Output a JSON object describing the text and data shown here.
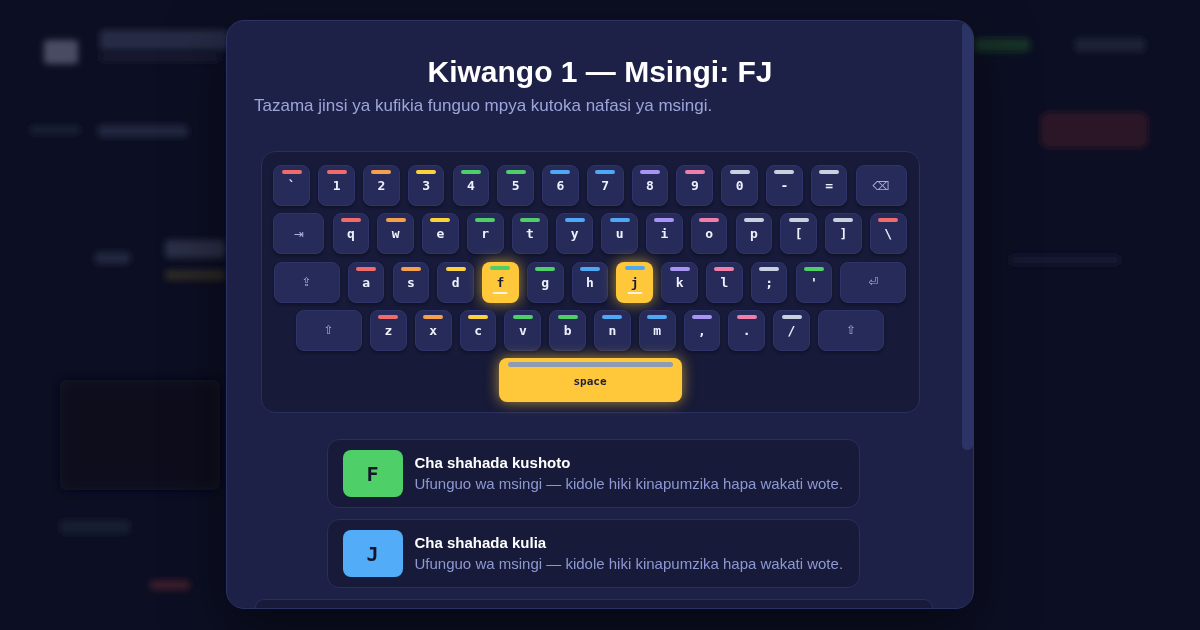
{
  "dialog": {
    "title": "Kiwango 1 — Msingi: FJ",
    "subtitle": "Tazama jinsi ya kufikia funguo mpya kutoka nafasi ya msingi.",
    "keyboard": {
      "rows": [
        [
          {
            "label": "`",
            "kind": "char",
            "color": "#f26b6b",
            "highlighted": false,
            "bump": false
          },
          {
            "label": "1",
            "kind": "char",
            "color": "#f26b6b",
            "highlighted": false,
            "bump": false
          },
          {
            "label": "2",
            "kind": "char",
            "color": "#f7a04b",
            "highlighted": false,
            "bump": false
          },
          {
            "label": "3",
            "kind": "char",
            "color": "#fdd23c",
            "highlighted": false,
            "bump": false
          },
          {
            "label": "4",
            "kind": "char",
            "color": "#4fcf67",
            "highlighted": false,
            "bump": false
          },
          {
            "label": "5",
            "kind": "char",
            "color": "#4fcf67",
            "highlighted": false,
            "bump": false
          },
          {
            "label": "6",
            "kind": "char",
            "color": "#4ea8f4",
            "highlighted": false,
            "bump": false
          },
          {
            "label": "7",
            "kind": "char",
            "color": "#4ea8f4",
            "highlighted": false,
            "bump": false
          },
          {
            "label": "8",
            "kind": "char",
            "color": "#a895f3",
            "highlighted": false,
            "bump": false
          },
          {
            "label": "9",
            "kind": "char",
            "color": "#f07ea8",
            "highlighted": false,
            "bump": false
          },
          {
            "label": "0",
            "kind": "char",
            "color": "#c9d0df",
            "highlighted": false,
            "bump": false
          },
          {
            "label": "-",
            "kind": "char",
            "color": "#c9d0df",
            "highlighted": false,
            "bump": false
          },
          {
            "label": "=",
            "kind": "char",
            "color": "#c9d0df",
            "highlighted": false,
            "bump": false
          },
          {
            "label": "⌫",
            "kind": "backspace",
            "highlighted": false,
            "bump": false
          }
        ],
        [
          {
            "label": "⇥",
            "kind": "tab",
            "highlighted": false,
            "bump": false
          },
          {
            "label": "q",
            "kind": "char",
            "color": "#f26b6b",
            "highlighted": false,
            "bump": false
          },
          {
            "label": "w",
            "kind": "char",
            "color": "#f7a04b",
            "highlighted": false,
            "bump": false
          },
          {
            "label": "e",
            "kind": "char",
            "color": "#fdd23c",
            "highlighted": false,
            "bump": false
          },
          {
            "label": "r",
            "kind": "char",
            "color": "#4fcf67",
            "highlighted": false,
            "bump": false
          },
          {
            "label": "t",
            "kind": "char",
            "color": "#4fcf67",
            "highlighted": false,
            "bump": false
          },
          {
            "label": "y",
            "kind": "char",
            "color": "#4ea8f4",
            "highlighted": false,
            "bump": false
          },
          {
            "label": "u",
            "kind": "char",
            "color": "#4ea8f4",
            "highlighted": false,
            "bump": false
          },
          {
            "label": "i",
            "kind": "char",
            "color": "#a895f3",
            "highlighted": false,
            "bump": false
          },
          {
            "label": "o",
            "kind": "char",
            "color": "#f07ea8",
            "highlighted": false,
            "bump": false
          },
          {
            "label": "p",
            "kind": "char",
            "color": "#c9d0df",
            "highlighted": false,
            "bump": false
          },
          {
            "label": "[",
            "kind": "char",
            "color": "#c9d0df",
            "highlighted": false,
            "bump": false
          },
          {
            "label": "]",
            "kind": "char",
            "color": "#c9d0df",
            "highlighted": false,
            "bump": false
          },
          {
            "label": "\\",
            "kind": "char",
            "color": "#f26b6b",
            "highlighted": false,
            "bump": false
          }
        ],
        [
          {
            "label": "⇪",
            "kind": "caps",
            "highlighted": false,
            "bump": false
          },
          {
            "label": "a",
            "kind": "char",
            "color": "#f26b6b",
            "highlighted": false,
            "bump": false
          },
          {
            "label": "s",
            "kind": "char",
            "color": "#f7a04b",
            "highlighted": false,
            "bump": false
          },
          {
            "label": "d",
            "kind": "char",
            "color": "#fdd23c",
            "highlighted": false,
            "bump": false
          },
          {
            "label": "f",
            "kind": "char",
            "color": "#4fcf67",
            "highlighted": true,
            "bump": true
          },
          {
            "label": "g",
            "kind": "char",
            "color": "#4fcf67",
            "highlighted": false,
            "bump": false
          },
          {
            "label": "h",
            "kind": "char",
            "color": "#4ea8f4",
            "highlighted": false,
            "bump": false
          },
          {
            "label": "j",
            "kind": "char",
            "color": "#4ea8f4",
            "highlighted": true,
            "bump": true
          },
          {
            "label": "k",
            "kind": "char",
            "color": "#a895f3",
            "highlighted": false,
            "bump": false
          },
          {
            "label": "l",
            "kind": "char",
            "color": "#f07ea8",
            "highlighted": false,
            "bump": false
          },
          {
            "label": ";",
            "kind": "char",
            "color": "#c9d0df",
            "highlighted": false,
            "bump": false
          },
          {
            "label": "'",
            "kind": "char",
            "color": "#4fcf67",
            "highlighted": false,
            "bump": false
          },
          {
            "label": "⏎",
            "kind": "enter",
            "highlighted": false,
            "bump": false
          }
        ],
        [
          {
            "label": "⇧",
            "kind": "shift",
            "highlighted": false,
            "bump": false
          },
          {
            "label": "z",
            "kind": "char",
            "color": "#f26b6b",
            "highlighted": false,
            "bump": false
          },
          {
            "label": "x",
            "kind": "char",
            "color": "#f7a04b",
            "highlighted": false,
            "bump": false
          },
          {
            "label": "c",
            "kind": "char",
            "color": "#fdd23c",
            "highlighted": false,
            "bump": false
          },
          {
            "label": "v",
            "kind": "char",
            "color": "#4fcf67",
            "highlighted": false,
            "bump": false
          },
          {
            "label": "b",
            "kind": "char",
            "color": "#4fcf67",
            "highlighted": false,
            "bump": false
          },
          {
            "label": "n",
            "kind": "char",
            "color": "#4ea8f4",
            "highlighted": false,
            "bump": false
          },
          {
            "label": "m",
            "kind": "char",
            "color": "#4ea8f4",
            "highlighted": false,
            "bump": false
          },
          {
            "label": ",",
            "kind": "char",
            "color": "#a895f3",
            "highlighted": false,
            "bump": false
          },
          {
            "label": ".",
            "kind": "char",
            "color": "#f07ea8",
            "highlighted": false,
            "bump": false
          },
          {
            "label": "/",
            "kind": "char",
            "color": "#c9d0df",
            "highlighted": false,
            "bump": false
          },
          {
            "label": "⇧",
            "kind": "shift",
            "highlighted": false,
            "bump": false
          }
        ],
        [
          {
            "label": "space",
            "kind": "space",
            "color": "#8e9bb4",
            "highlighted": true,
            "bump": false
          }
        ]
      ]
    },
    "new_keys": [
      {
        "letter": "F",
        "color": "#4fcf67",
        "title": "Cha shahada kushoto",
        "description": "Ufunguo wa msingi — kidole hiki kinapumzika hapa wakati wote."
      },
      {
        "letter": "J",
        "color": "#52acf7",
        "title": "Cha shahada kulia",
        "description": "Ufunguo wa msingi — kidole hiki kinapumzika hapa wakati wote."
      }
    ]
  }
}
